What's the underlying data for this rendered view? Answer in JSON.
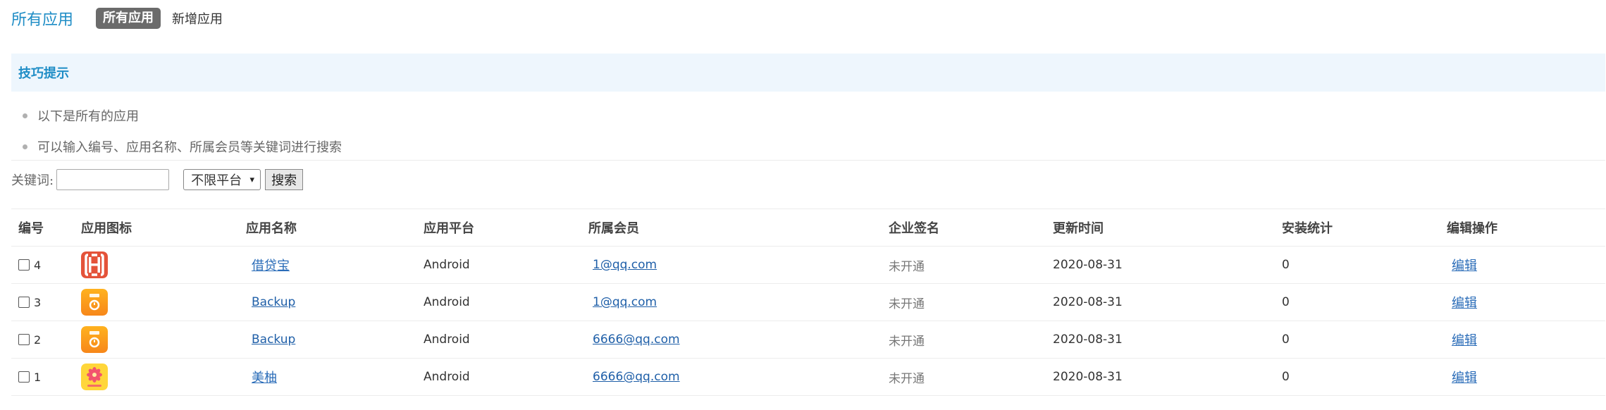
{
  "header": {
    "title": "所有应用",
    "tabs": [
      {
        "label": "所有应用",
        "active": true
      },
      {
        "label": "新增应用",
        "active": false
      }
    ]
  },
  "tips": {
    "heading": "技巧提示",
    "items": [
      "以下是所有的应用",
      "可以输入编号、应用名称、所属会员等关键词进行搜索"
    ]
  },
  "search": {
    "label": "关键词:",
    "value": "",
    "placeholder": "",
    "platform_selected": "不限平台",
    "button_label": "搜索"
  },
  "table": {
    "columns": [
      "编号",
      "应用图标",
      "应用名称",
      "应用平台",
      "所属会员",
      "企业签名",
      "更新时间",
      "安装统计",
      "编辑操作"
    ],
    "rows": [
      {
        "id": "4",
        "icon": "jiedaibao-icon",
        "name": "借贷宝",
        "platform": "Android",
        "member": "1@qq.com",
        "signature": "未开通",
        "updated": "2020-08-31",
        "installs": "0",
        "action": "编辑"
      },
      {
        "id": "3",
        "icon": "backup-icon",
        "name": "Backup",
        "platform": "Android",
        "member": "1@qq.com",
        "signature": "未开通",
        "updated": "2020-08-31",
        "installs": "0",
        "action": "编辑"
      },
      {
        "id": "2",
        "icon": "backup-icon",
        "name": "Backup",
        "platform": "Android",
        "member": "6666@qq.com",
        "signature": "未开通",
        "updated": "2020-08-31",
        "installs": "0",
        "action": "编辑"
      },
      {
        "id": "1",
        "icon": "meiyou-icon",
        "name": "美柚",
        "platform": "Android",
        "member": "6666@qq.com",
        "signature": "未开通",
        "updated": "2020-08-31",
        "installs": "0",
        "action": "编辑"
      }
    ]
  },
  "colors": {
    "accent": "#1f8dc6",
    "link": "#2a6cb8",
    "tips_bg": "#eef6fd",
    "active_tab_bg": "#6b6b6b"
  }
}
